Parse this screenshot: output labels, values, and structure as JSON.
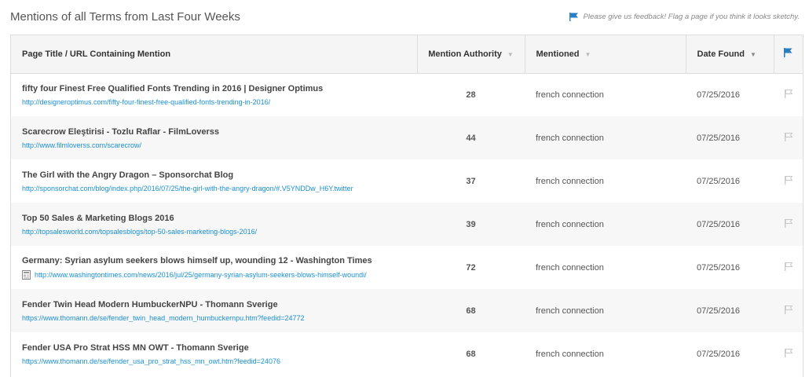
{
  "header": {
    "title": "Mentions of all Terms from Last Four Weeks",
    "feedback_text": "Please give us feedback! Flag a page if you think it looks sketchy."
  },
  "colors": {
    "accent": "#1a8fd0",
    "flag_blue": "#2a7fc1",
    "flag_grey": "#c8c8c8"
  },
  "table": {
    "columns": {
      "page": "Page Title / URL Containing Mention",
      "authority": "Mention Authority",
      "mentioned": "Mentioned",
      "date": "Date Found"
    },
    "rows": [
      {
        "title": "fifty four Finest Free Qualified Fonts Trending in 2016 | Designer Optimus",
        "url": "http://designeroptimus.com/fifty-four-finest-free-qualified-fonts-trending-in-2016/",
        "authority": "28",
        "mentioned": "french connection",
        "date": "07/25/2016",
        "news": false
      },
      {
        "title": "Scarecrow Eleştirisi - Tozlu Raflar - FilmLoverss",
        "url": "http://www.filmloverss.com/scarecrow/",
        "authority": "44",
        "mentioned": "french connection",
        "date": "07/25/2016",
        "news": false
      },
      {
        "title": "The Girl with the Angry Dragon – Sponsorchat Blog",
        "url": "http://sponsorchat.com/blog/index.php/2016/07/25/the-girl-with-the-angry-dragon/#.V5YNDDw_H6Y.twitter",
        "authority": "37",
        "mentioned": "french connection",
        "date": "07/25/2016",
        "news": false
      },
      {
        "title": "Top 50 Sales & Marketing Blogs 2016",
        "url": "http://topsalesworld.com/topsalesblogs/top-50-sales-marketing-blogs-2016/",
        "authority": "39",
        "mentioned": "french connection",
        "date": "07/25/2016",
        "news": false
      },
      {
        "title": "Germany: Syrian asylum seekers blows himself up, wounding 12 - Washington Times",
        "url": "http://www.washingtontimes.com/news/2016/jul/25/germany-syrian-asylum-seekers-blows-himself-woundi/",
        "authority": "72",
        "mentioned": "french connection",
        "date": "07/25/2016",
        "news": true
      },
      {
        "title": "Fender Twin Head Modern HumbuckerNPU - Thomann Sverige",
        "url": "https://www.thomann.de/se/fender_twin_head_modern_humbuckernpu.htm?feedid=24772",
        "authority": "68",
        "mentioned": "french connection",
        "date": "07/25/2016",
        "news": false
      },
      {
        "title": "Fender USA Pro Strat HSS MN OWT - Thomann Sverige",
        "url": "https://www.thomann.de/se/fender_usa_pro_strat_hss_mn_owt.htm?feedid=24076",
        "authority": "68",
        "mentioned": "french connection",
        "date": "07/25/2016",
        "news": false
      }
    ]
  }
}
